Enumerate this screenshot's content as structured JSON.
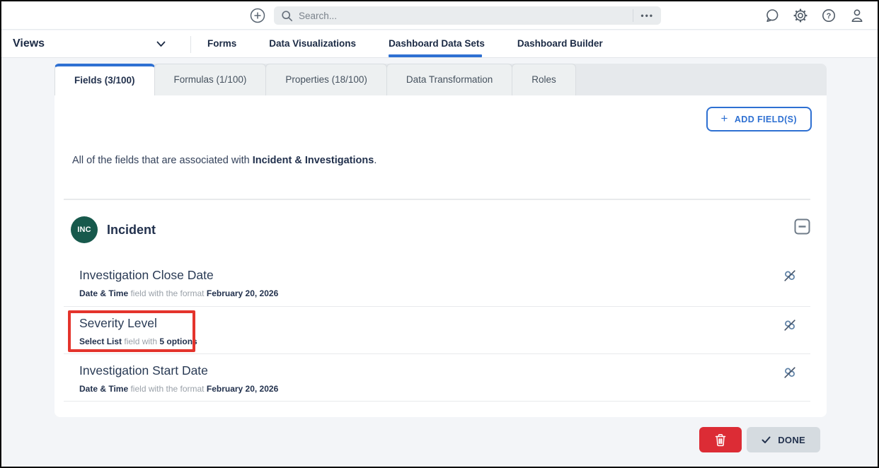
{
  "topbar": {
    "search_placeholder": "Search...",
    "overflow_dots": "•••",
    "icons": [
      "plus-circle",
      "search",
      "more-options",
      "chat",
      "settings",
      "help",
      "profile"
    ]
  },
  "nav": {
    "views_label": "Views",
    "items": [
      {
        "label": "Forms",
        "active": false
      },
      {
        "label": "Data Visualizations",
        "active": false
      },
      {
        "label": "Dashboard Data Sets",
        "active": true
      },
      {
        "label": "Dashboard Builder",
        "active": false
      }
    ]
  },
  "tabs": [
    {
      "label": "Fields (3/100)",
      "active": true
    },
    {
      "label": "Formulas (1/100)",
      "active": false
    },
    {
      "label": "Properties (18/100)",
      "active": false
    },
    {
      "label": "Data Transformation",
      "active": false
    },
    {
      "label": "Roles",
      "active": false
    }
  ],
  "content": {
    "add_button": {
      "plus": "+",
      "label": "ADD FIELD(S)"
    },
    "description": {
      "prefix": "All of the fields that are associated with ",
      "bold": "Incident & Investigations",
      "suffix": "."
    },
    "section": {
      "badge": "INC",
      "title": "Incident"
    },
    "fields": [
      {
        "name": "Investigation Close Date",
        "type": "Date & Time",
        "connector": " field with the format ",
        "value": "February 20, 2026",
        "highlighted": false
      },
      {
        "name": "Severity Level",
        "type": "Select List",
        "connector": " field with ",
        "value": "5 options",
        "highlighted": true
      },
      {
        "name": "Investigation Start Date",
        "type": "Date & Time",
        "connector": " field with the format ",
        "value": "February 20, 2026",
        "highlighted": false
      }
    ]
  },
  "footer": {
    "done_label": "DONE"
  },
  "colors": {
    "accent_blue": "#2E70D2",
    "badge_teal": "#17594C",
    "annotation_red": "#E4342C",
    "danger_red": "#DC2C35",
    "heading_navy": "#22314D"
  }
}
